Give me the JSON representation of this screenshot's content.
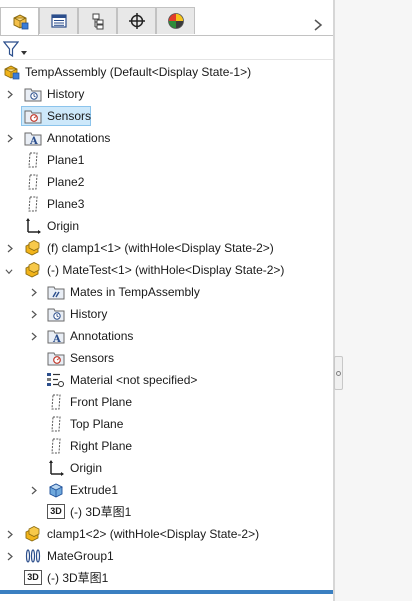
{
  "tabs": [
    {
      "name": "feature-manager",
      "icon": "feature-tree-icon",
      "active": true
    },
    {
      "name": "property-manager",
      "icon": "property-manager-icon",
      "active": false
    },
    {
      "name": "configuration-manager",
      "icon": "configuration-manager-icon",
      "active": false
    },
    {
      "name": "dimxpert-manager",
      "icon": "crosshair-icon",
      "active": false
    },
    {
      "name": "display-manager",
      "icon": "appearance-sphere-icon",
      "active": false
    }
  ],
  "tree": {
    "root": {
      "label": "TempAssembly  (Default<Display State-1>)"
    },
    "history": {
      "label": "History"
    },
    "sensors": {
      "label": "Sensors"
    },
    "annotations": {
      "label": "Annotations"
    },
    "plane1": {
      "label": "Plane1"
    },
    "plane2": {
      "label": "Plane2"
    },
    "plane3": {
      "label": "Plane3"
    },
    "origin": {
      "label": "Origin"
    },
    "clamp1": {
      "label": "(f) clamp1<1> (withHole<Display State-2>)"
    },
    "matetest": {
      "label": "(-) MateTest<1> (withHole<Display State-2>)"
    },
    "mates": {
      "label": "Mates in TempAssembly"
    },
    "mt_history": {
      "label": "History"
    },
    "mt_annotations": {
      "label": "Annotations"
    },
    "mt_sensors": {
      "label": "Sensors"
    },
    "material": {
      "label": "Material <not specified>"
    },
    "front_plane": {
      "label": "Front Plane"
    },
    "top_plane": {
      "label": "Top Plane"
    },
    "right_plane": {
      "label": "Right Plane"
    },
    "mt_origin": {
      "label": "Origin"
    },
    "extrude1": {
      "label": "Extrude1"
    },
    "mt_sketch": {
      "label": "(-) 3D草图1",
      "badge": "3D"
    },
    "clamp2": {
      "label": "clamp1<2> (withHole<Display State-2>)"
    },
    "mategroup": {
      "label": "MateGroup1"
    },
    "sketch": {
      "label": "(-) 3D草图1",
      "badge": "3D"
    }
  },
  "colors": {
    "selection": "#cde8fa",
    "selection_border": "#8cc4ec",
    "part_yellow": "#f2b41a",
    "accent_blue": "#3a7fc1"
  }
}
